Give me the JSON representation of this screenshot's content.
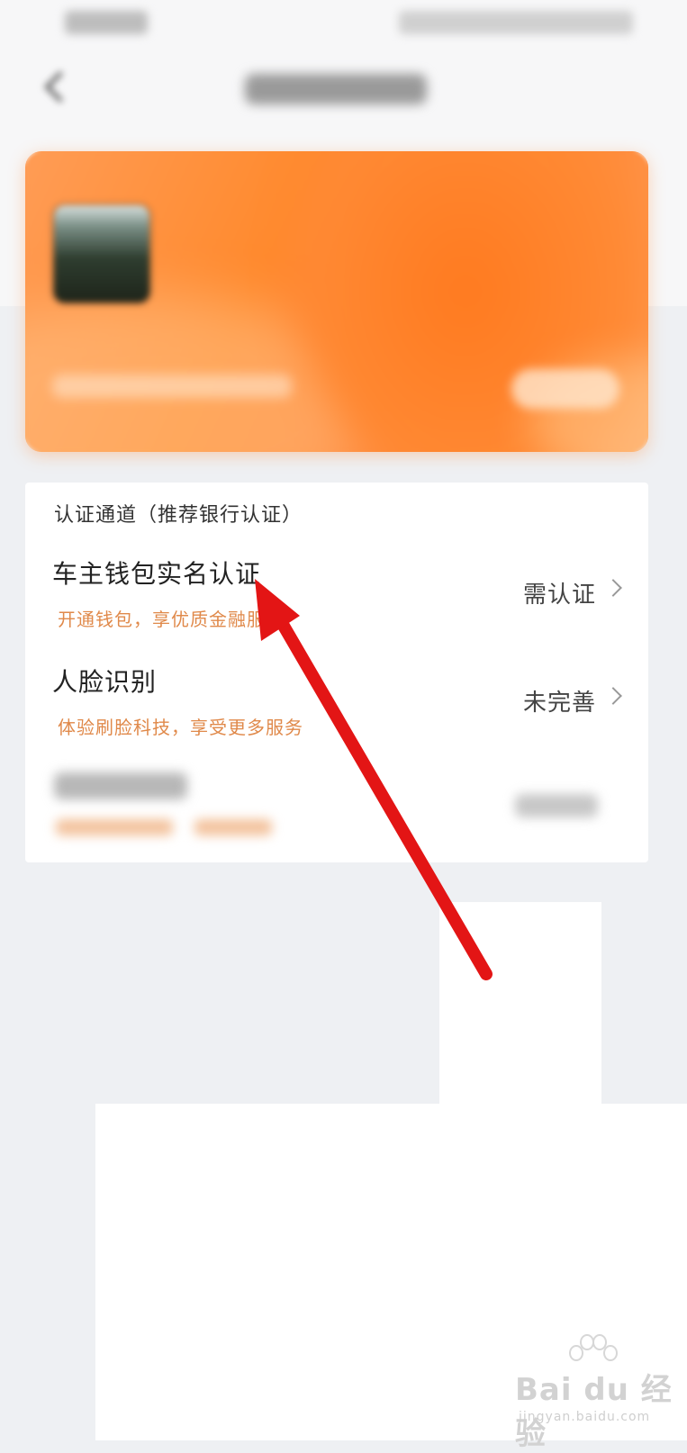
{
  "section": {
    "title": "认证通道（推荐银行认证）"
  },
  "rows": [
    {
      "title": "车主钱包实名认证",
      "desc": "开通钱包，享优质金融服务",
      "status": "需认证"
    },
    {
      "title": "人脸识别",
      "desc": "体验刷脸科技，享受更多服务",
      "status": "未完善"
    }
  ],
  "watermark": {
    "brand": "Bai du 经验",
    "url": "jingyan.baidu.com"
  },
  "colors": {
    "card_accent": "#ff8a2e",
    "desc_orange": "#e0894a",
    "arrow_red": "#e31515"
  },
  "icons": {
    "back": "chevron-left-icon",
    "row_arrow": "chevron-right-icon",
    "watermark_logo": "paw-icon"
  }
}
